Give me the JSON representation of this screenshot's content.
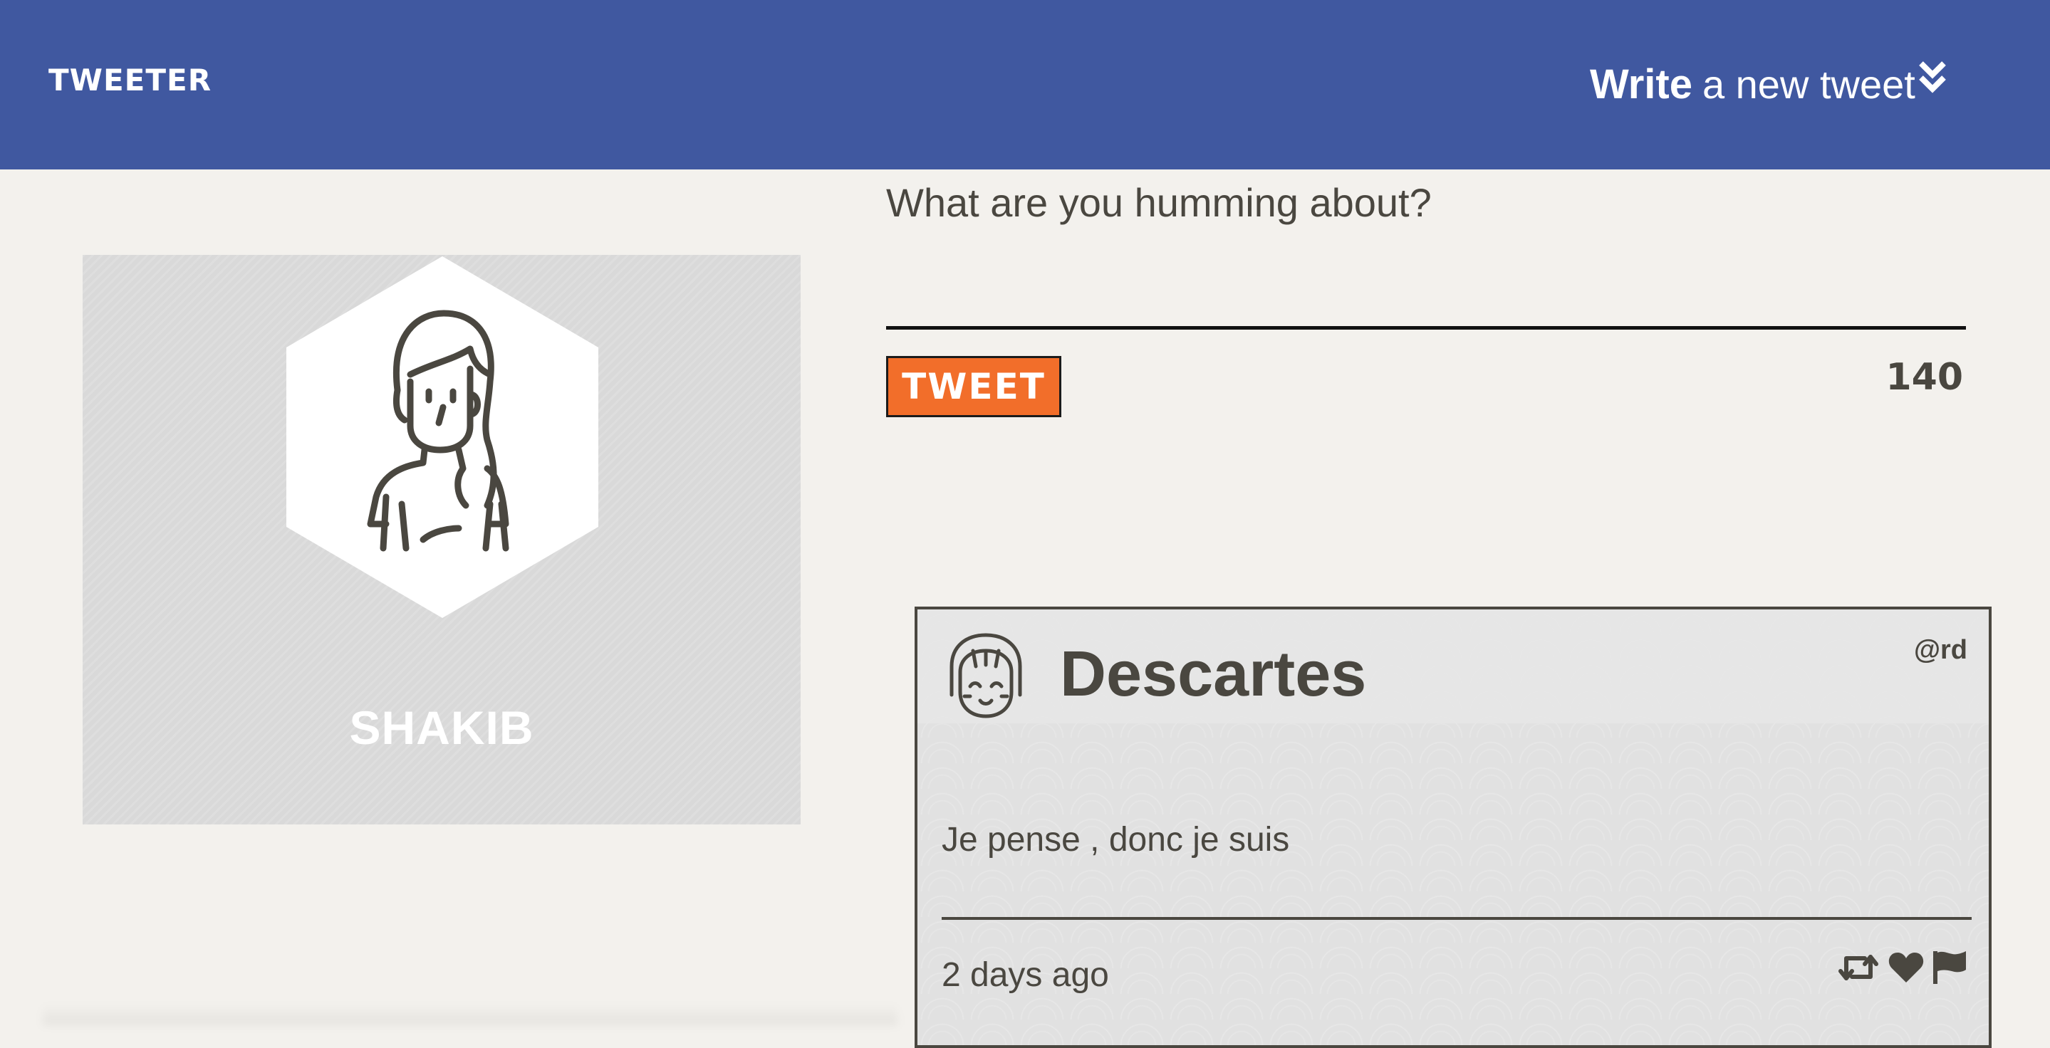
{
  "nav": {
    "brand": "TWEETER",
    "compose_strong": "Write",
    "compose_light": "a new tweet",
    "compose_icon": "double-chevron-down-icon"
  },
  "profile": {
    "name": "SHAKIB",
    "avatar_icon": "woman-avatar-icon"
  },
  "composer": {
    "prompt": "What are you humming about?",
    "input_value": "",
    "button_label": "TWEET",
    "counter": "140"
  },
  "tweet": {
    "author": "Descartes",
    "handle": "@rd",
    "body": "Je pense , donc je suis",
    "time": "2 days ago",
    "avatar_icon": "girl-face-avatar-icon",
    "actions": [
      "retweet-icon",
      "heart-icon",
      "flag-icon"
    ]
  },
  "colors": {
    "nav_bg": "#4058a0",
    "page_bg": "#f3f1ed",
    "accent": "#f26e2a",
    "text": "#4a4740"
  }
}
